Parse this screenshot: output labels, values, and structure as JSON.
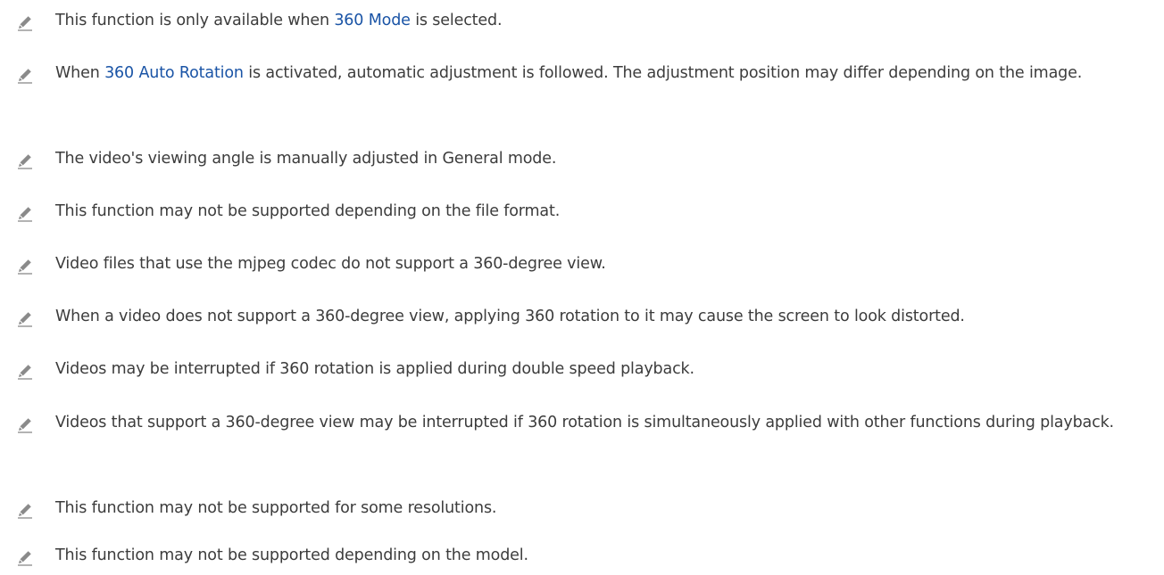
{
  "colors": {
    "text": "#3c3c3c",
    "highlight": "#1a54a6",
    "icon": "#8a8a8a"
  },
  "icon": "pencil-note-icon",
  "notes": [
    {
      "before": "This function is only available when ",
      "highlight": "360 Mode",
      "after": " is selected."
    },
    {
      "before": "When ",
      "highlight": "360 Auto Rotation",
      "after": " is activated, automatic adjustment is followed. The adjustment position may differ depending on the image."
    },
    {
      "text": "The video's viewing angle is manually adjusted in General mode."
    },
    {
      "text": "This function may not be supported depending on the file format."
    },
    {
      "text": "Video files that use the mjpeg codec do not support a 360-degree view."
    },
    {
      "text": "When a video does not support a 360-degree view, applying 360 rotation to it may cause the screen to look distorted."
    },
    {
      "text": "Videos may be interrupted if 360 rotation is applied during double speed playback."
    },
    {
      "text": "Videos that support a 360-degree view may be interrupted if 360 rotation is simultaneously applied with other functions during playback."
    },
    {
      "text": "This function may not be supported for some resolutions."
    },
    {
      "text": "This function may not be supported depending on the model."
    }
  ]
}
